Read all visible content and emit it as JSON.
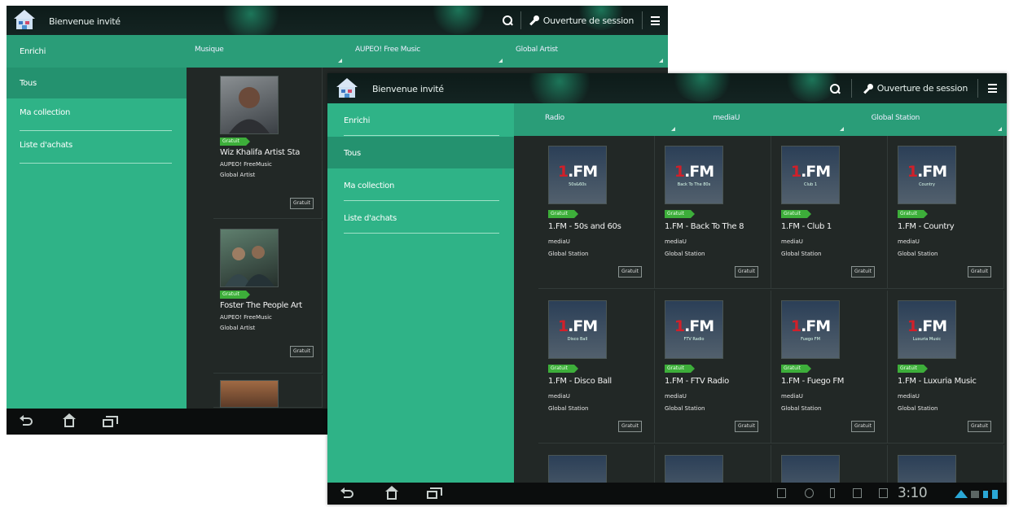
{
  "back_screen": {
    "header": {
      "title": "Bienvenue invité",
      "login_label": "Ouverture de session"
    },
    "sidebar": {
      "heading": "Enrichi",
      "active": "Tous",
      "items": [
        "Ma collection",
        "Liste d'achats"
      ]
    },
    "filters": [
      "Musique",
      "AUPEO! Free Music",
      "Global Artist"
    ],
    "cards": [
      {
        "name": "Wiz Khalifa Artist Sta",
        "provider": "AUPEO! FreeMusic",
        "category": "Global Artist",
        "badge": "Gratuit",
        "price": "Gratuit"
      },
      {
        "name": "Foster The People Art",
        "provider": "AUPEO! FreeMusic",
        "category": "Global Artist",
        "badge": "Gratuit",
        "price": "Gratuit"
      }
    ]
  },
  "front_screen": {
    "header": {
      "title": "Bienvenue invité",
      "login_label": "Ouverture de session"
    },
    "sidebar": {
      "heading": "Enrichi",
      "active": "Tous",
      "items": [
        "Ma collection",
        "Liste d'achats"
      ]
    },
    "filters": [
      "Radio",
      "mediaU",
      "Global Station"
    ],
    "cards": [
      {
        "logo": "1.FM",
        "subtitle": "50s&60s",
        "name": "1.FM - 50s and 60s",
        "provider": "mediaU",
        "category": "Global Station",
        "badge": "Gratuit",
        "price": "Gratuit"
      },
      {
        "logo": "1.FM",
        "subtitle": "Back To The 80s",
        "name": "1.FM - Back To The 8",
        "provider": "mediaU",
        "category": "Global Station",
        "badge": "Gratuit",
        "price": "Gratuit"
      },
      {
        "logo": "1.FM",
        "subtitle": "Club 1",
        "name": "1.FM - Club 1",
        "provider": "mediaU",
        "category": "Global Station",
        "badge": "Gratuit",
        "price": "Gratuit"
      },
      {
        "logo": "1.FM",
        "subtitle": "Country",
        "name": "1.FM - Country",
        "provider": "mediaU",
        "category": "Global Station",
        "badge": "Gratuit",
        "price": "Gratuit"
      },
      {
        "logo": "1.FM",
        "subtitle": "Disco Ball",
        "name": "1.FM - Disco Ball",
        "provider": "mediaU",
        "category": "Global Station",
        "badge": "Gratuit",
        "price": "Gratuit"
      },
      {
        "logo": "1.FM",
        "subtitle": "FTV Radio",
        "name": "1.FM - FTV Radio",
        "provider": "mediaU",
        "category": "Global Station",
        "badge": "Gratuit",
        "price": "Gratuit"
      },
      {
        "logo": "1.FM",
        "subtitle": "Fuego FM",
        "name": "1.FM - Fuego FM",
        "provider": "mediaU",
        "category": "Global Station",
        "badge": "Gratuit",
        "price": "Gratuit"
      },
      {
        "logo": "1.FM",
        "subtitle": "Luxuria Music",
        "name": "1.FM - Luxuria Music",
        "provider": "mediaU",
        "category": "Global Station",
        "badge": "Gratuit",
        "price": "Gratuit"
      }
    ],
    "status": {
      "time": "3:10"
    }
  },
  "colors": {
    "accent": "#2fb387",
    "filter_bar": "#2a9d78",
    "badge": "#3dae3a",
    "background": "#1e2423"
  }
}
